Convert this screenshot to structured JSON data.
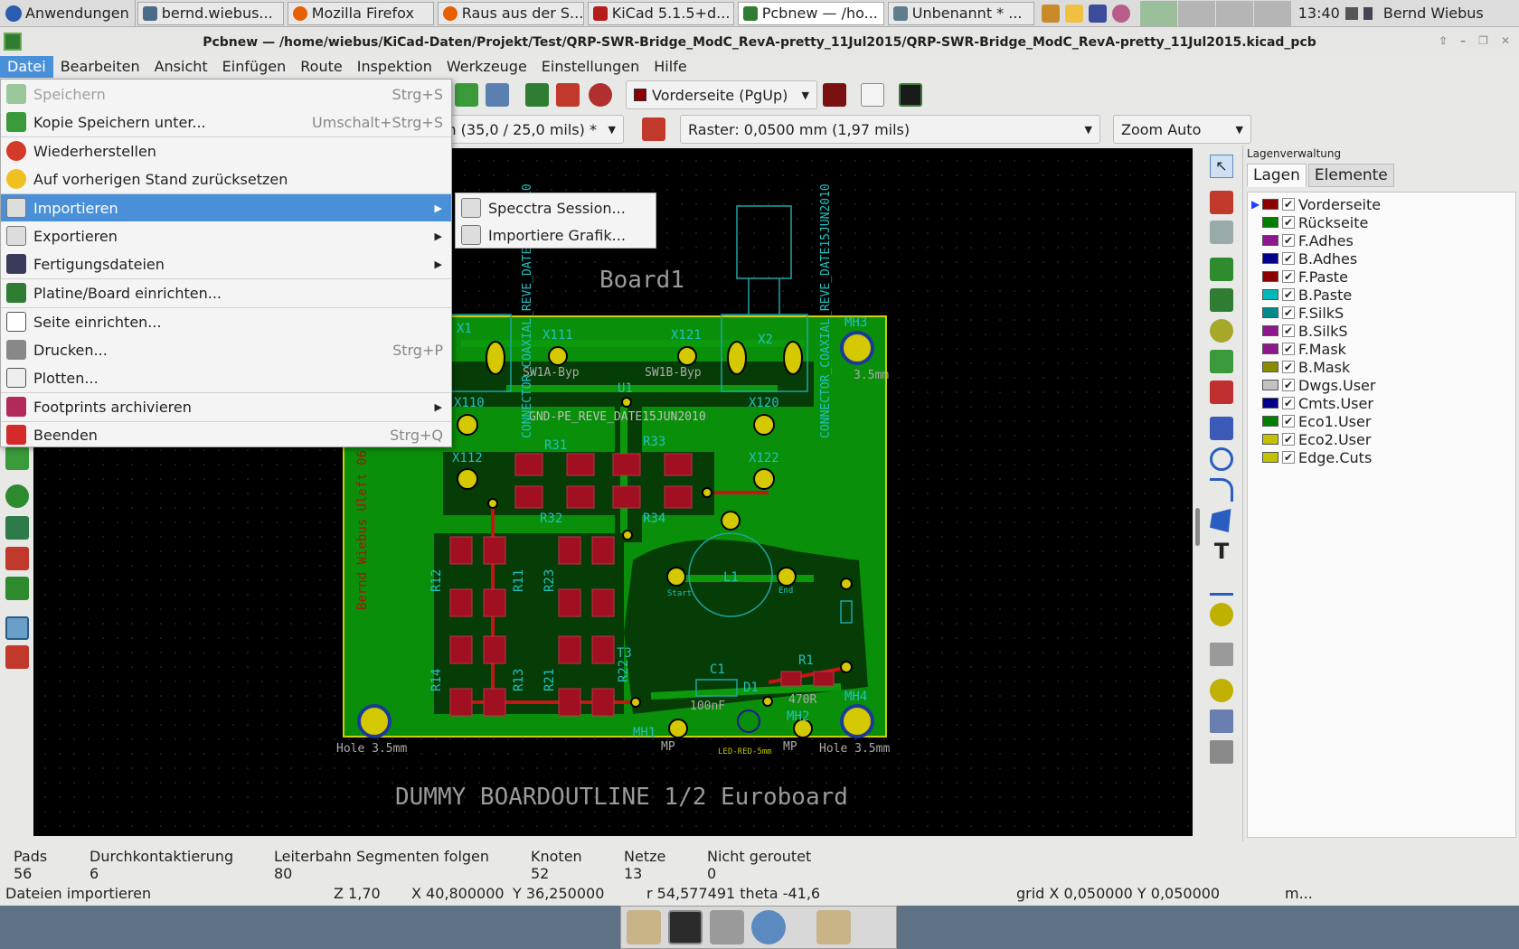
{
  "taskbar": {
    "start_label": "Anwendungen",
    "tasks": [
      {
        "label": "bernd.wiebus...",
        "icon": "terminal-icon"
      },
      {
        "label": "Mozilla Firefox",
        "icon": "firefox-icon"
      },
      {
        "label": "Raus aus der S...",
        "icon": "firefox-icon"
      },
      {
        "label": "KiCad 5.1.5+d...",
        "icon": "kicad-icon"
      },
      {
        "label": "Pcbnew — /ho...",
        "icon": "pcbnew-icon"
      },
      {
        "label": "Unbenannt * ...",
        "icon": "editor-icon"
      }
    ],
    "clock": "13:40",
    "user": "Bernd Wiebus"
  },
  "window": {
    "title": "Pcbnew — /home/wiebus/KiCad-Daten/Projekt/Test/QRP-SWR-Bridge_ModC_RevA-pretty_11Jul2015/QRP-SWR-Bridge_ModC_RevA-pretty_11Jul2015.kicad_pcb"
  },
  "menubar": [
    "Datei",
    "Bearbeiten",
    "Ansicht",
    "Einfügen",
    "Route",
    "Inspektion",
    "Werkzeuge",
    "Einstellungen",
    "Hilfe"
  ],
  "file_menu": [
    {
      "label": "Speichern",
      "shortcut": "Strg+S",
      "disabled": true,
      "icon": "save-icon"
    },
    {
      "label": "Kopie Speichern unter...",
      "shortcut": "Umschalt+Strg+S",
      "icon": "save-copy-icon"
    },
    {
      "label": "Wiederherstellen",
      "shortcut": "",
      "icon": "restore-icon"
    },
    {
      "label": "Auf vorherigen Stand zurücksetzen",
      "shortcut": "",
      "icon": "revert-icon"
    },
    {
      "label": "Importieren",
      "submenu": true,
      "highlighted": true,
      "icon": "import-icon"
    },
    {
      "label": "Exportieren",
      "submenu": true,
      "icon": "export-icon"
    },
    {
      "label": "Fertigungsdateien",
      "submenu": true,
      "icon": "fabrication-icon"
    },
    {
      "label": "Platine/Board einrichten...",
      "icon": "board-setup-icon"
    },
    {
      "label": "Seite einrichten...",
      "icon": "page-setup-icon"
    },
    {
      "label": "Drucken...",
      "shortcut": "Strg+P",
      "icon": "print-icon"
    },
    {
      "label": "Plotten...",
      "icon": "plot-icon"
    },
    {
      "label": "Footprints archivieren",
      "submenu": true,
      "icon": "archive-icon"
    },
    {
      "label": "Beenden",
      "shortcut": "Strg+Q",
      "icon": "quit-icon"
    }
  ],
  "import_submenu": [
    "Specctra Session...",
    "Importiere Grafik..."
  ],
  "toolbar": {
    "layer_select": "Vorderseite (PgUp)",
    "track_width": "m (35,0 / 25,0 mils) *",
    "grid": "Raster: 0,0500 mm (1,97 mils)",
    "zoom": "Zoom Auto"
  },
  "canvas": {
    "board_label": "Board1",
    "outline_label": "DUMMY BOARDOUTLINE 1/2 Euroboard",
    "silk_vertical": "Bernd Wiebus Uleft 06 August 2010 QRP-SWR-Bridge 50 Ohm/5W",
    "refs": [
      "X1",
      "X111",
      "X121",
      "X2",
      "MH3",
      "X110",
      "X120",
      "U1",
      "X112",
      "X122",
      "R31",
      "R33",
      "R32",
      "R34",
      "L1",
      "R12",
      "R11",
      "R23",
      "R14",
      "R13",
      "R21",
      "R22",
      "C1",
      "R1",
      "MH1",
      "MH2",
      "MH4",
      "D1",
      "T3"
    ],
    "values": [
      "SW1A-Byp",
      "SW1B-Byp",
      "Hole 3.5mm",
      "Hole 3.5mm",
      "100nF",
      "470R",
      "MP",
      "MP",
      "LED-RED-5mm",
      "Start",
      "End",
      "GND-PE_REVE_DATE15JUN2010",
      "CONNECTOR_COAXIAL_REVE_DATE15JUN2010",
      "CONNECTOR_COAXIAL_REVE_DATE15JUN2010",
      "3.5mm"
    ]
  },
  "layers_panel": {
    "title": "Lagenverwaltung",
    "tabs": [
      "Lagen",
      "Elemente"
    ],
    "layers": [
      {
        "name": "Vorderseite",
        "color": "#8b0000",
        "current": true
      },
      {
        "name": "Rückseite",
        "color": "#008000"
      },
      {
        "name": "F.Adhes",
        "color": "#8e168e"
      },
      {
        "name": "B.Adhes",
        "color": "#00008b"
      },
      {
        "name": "F.Paste",
        "color": "#8b0000"
      },
      {
        "name": "B.Paste",
        "color": "#00b8b8"
      },
      {
        "name": "F.SilkS",
        "color": "#008b8b"
      },
      {
        "name": "B.SilkS",
        "color": "#8e168e"
      },
      {
        "name": "F.Mask",
        "color": "#8e168e"
      },
      {
        "name": "B.Mask",
        "color": "#8b8b00"
      },
      {
        "name": "Dwgs.User",
        "color": "#c2c2c2"
      },
      {
        "name": "Cmts.User",
        "color": "#00008b"
      },
      {
        "name": "Eco1.User",
        "color": "#008000"
      },
      {
        "name": "Eco2.User",
        "color": "#c2c200"
      },
      {
        "name": "Edge.Cuts",
        "color": "#c2c200"
      }
    ]
  },
  "status": {
    "columns": [
      {
        "label": "Pads",
        "value": "56"
      },
      {
        "label": "Durchkontaktierung",
        "value": "6"
      },
      {
        "label": "Leiterbahn Segmenten folgen",
        "value": "80"
      },
      {
        "label": "Knoten",
        "value": "52"
      },
      {
        "label": "Netze",
        "value": "13"
      },
      {
        "label": "Nicht geroutet",
        "value": "0"
      }
    ],
    "message": "Dateien importieren",
    "zoom": "Z 1,70",
    "x": "X 40,800000",
    "y": "Y 36,250000",
    "polar": "r 54,577491  theta -41,6",
    "grid": "grid X 0,050000  Y 0,050000",
    "units": "m..."
  }
}
